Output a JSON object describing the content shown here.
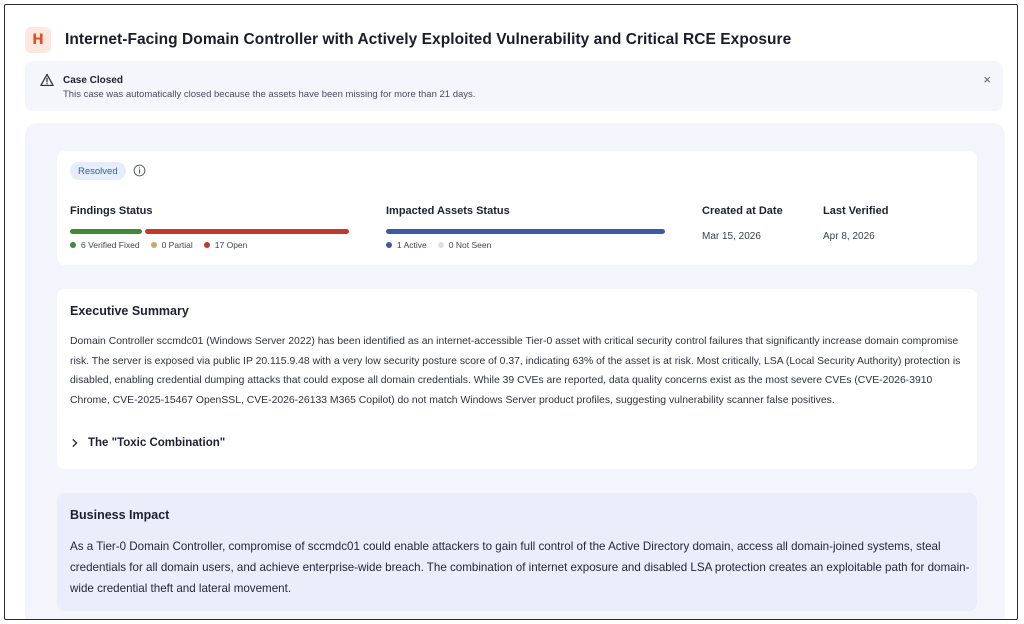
{
  "header": {
    "logo_letter": "H",
    "title": "Internet-Facing Domain Controller with Actively Exploited Vulnerability and Critical RCE Exposure"
  },
  "banner": {
    "title": "Case Closed",
    "text": "This case was automatically closed because the assets have been missing for more than 21 days.",
    "close": "×"
  },
  "status": {
    "badge": "Resolved",
    "findings": {
      "label": "Findings Status",
      "segments": [
        {
          "label": "6 Verified Fixed",
          "count": 6,
          "color": "#3f8a37"
        },
        {
          "label": "0 Partial",
          "count": 0,
          "color": "#c8a86b"
        },
        {
          "label": "17 Open",
          "count": 17,
          "color": "#c0392b"
        }
      ]
    },
    "assets": {
      "label": "Impacted Assets Status",
      "segments": [
        {
          "label": "1 Active",
          "count": 1,
          "color": "#3a5aa6"
        },
        {
          "label": "0 Not Seen",
          "count": 0,
          "color": "#dcdfe6"
        }
      ]
    },
    "created": {
      "label": "Created at Date",
      "value": "Mar 15, 2026"
    },
    "verified": {
      "label": "Last Verified",
      "value": "Apr 8, 2026"
    }
  },
  "executive": {
    "title": "Executive Summary",
    "text": "Domain Controller sccmdc01 (Windows Server 2022) has been identified as an internet-accessible Tier-0 asset with critical security control failures that significantly increase domain compromise risk. The server is exposed via public IP 20.115.9.48 with a very low security posture score of 0.37, indicating 63% of the asset is at risk. Most critically, LSA (Local Security Authority) protection is disabled, enabling credential dumping attacks that could expose all domain credentials. While 39 CVEs are reported, data quality concerns exist as the most severe CVEs (CVE-2026-3910 Chrome, CVE-2025-15467 OpenSSL, CVE-2026-26133 M365 Copilot) do not match Windows Server product profiles, suggesting vulnerability scanner false positives.",
    "toxic_label": "The \"Toxic Combination\""
  },
  "impact": {
    "title": "Business Impact",
    "text": "As a Tier-0 Domain Controller, compromise of sccmdc01 could enable attackers to gain full control of the Active Directory domain, access all domain-joined systems, steal credentials for all domain users, and achieve enterprise-wide breach. The combination of internet exposure and disabled LSA protection creates an exploitable path for domain-wide credential theft and lateral movement."
  }
}
